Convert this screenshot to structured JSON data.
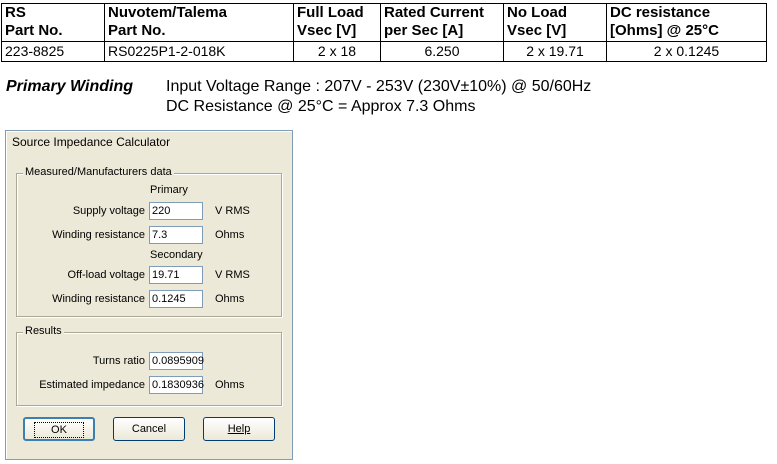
{
  "spec_table": {
    "headers": [
      [
        "RS",
        "Part No."
      ],
      [
        "Nuvotem/Talema",
        "Part No."
      ],
      [
        "Full Load",
        "Vsec [V]"
      ],
      [
        "Rated Current",
        "per Sec [A]"
      ],
      [
        "No Load",
        "Vsec [V]"
      ],
      [
        "DC resistance",
        "[Ohms] @ 25°C"
      ]
    ],
    "row": [
      "223-8825",
      "RS0225P1-2-018K",
      "2 x 18",
      "6.250",
      "2 x 19.71",
      "2 x 0.1245"
    ]
  },
  "primary_winding": {
    "label": "Primary Winding",
    "line1": "Input Voltage Range : 207V - 253V  (230V±10%) @ 50/60Hz",
    "line2": "DC Resistance @ 25°C = Approx 7.3 Ohms"
  },
  "dialog": {
    "title": "Source Impedance Calculator",
    "measured_group": {
      "caption": "Measured/Manufacturers data",
      "primary_heading": "Primary",
      "secondary_heading": "Secondary",
      "supply_voltage_label": "Supply voltage",
      "supply_voltage_value": "220",
      "supply_voltage_unit": "V RMS",
      "primary_resistance_label": "Winding resistance",
      "primary_resistance_value": "7.3",
      "primary_resistance_unit": "Ohms",
      "offload_voltage_label": "Off-load voltage",
      "offload_voltage_value": "19.71",
      "offload_voltage_unit": "V RMS",
      "secondary_resistance_label": "Winding resistance",
      "secondary_resistance_value": "0.1245",
      "secondary_resistance_unit": "Ohms"
    },
    "results_group": {
      "caption": "Results",
      "turns_ratio_label": "Turns ratio",
      "turns_ratio_value": "0.0895909",
      "impedance_label": "Estimated impedance",
      "impedance_value": "0.1830936",
      "impedance_unit": "Ohms"
    },
    "buttons": {
      "ok": "OK",
      "cancel": "Cancel",
      "help": "Help"
    }
  }
}
